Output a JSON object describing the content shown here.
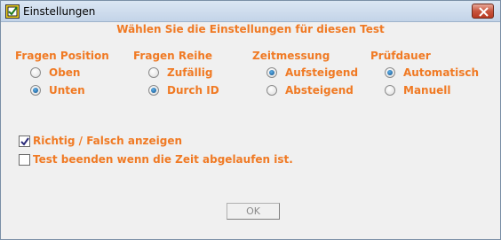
{
  "window": {
    "title": "Einstellungen",
    "heading": "Wählen Sie die Einstellungen für diesen Test"
  },
  "groups": [
    {
      "title": "Fragen Position",
      "options": [
        {
          "label": "Oben",
          "selected": false
        },
        {
          "label": "Unten",
          "selected": true
        }
      ]
    },
    {
      "title": "Fragen Reihe",
      "options": [
        {
          "label": "Zufällig",
          "selected": false
        },
        {
          "label": "Durch ID",
          "selected": true
        }
      ]
    },
    {
      "title": "Zeitmessung",
      "options": [
        {
          "label": "Aufsteigend",
          "selected": true
        },
        {
          "label": "Absteigend",
          "selected": false
        }
      ]
    },
    {
      "title": "Prüfdauer",
      "options": [
        {
          "label": "Automatisch",
          "selected": true
        },
        {
          "label": "Manuell",
          "selected": false
        }
      ]
    }
  ],
  "checkboxes": [
    {
      "label": "Richtig / Falsch anzeigen",
      "checked": true
    },
    {
      "label": "Test beenden wenn die Zeit abgelaufen ist.",
      "checked": false
    }
  ],
  "ok_label": "OK",
  "colors": {
    "accent": "#f07a24",
    "radio_selected": "#0d4f8b",
    "close": "#c8553e"
  }
}
